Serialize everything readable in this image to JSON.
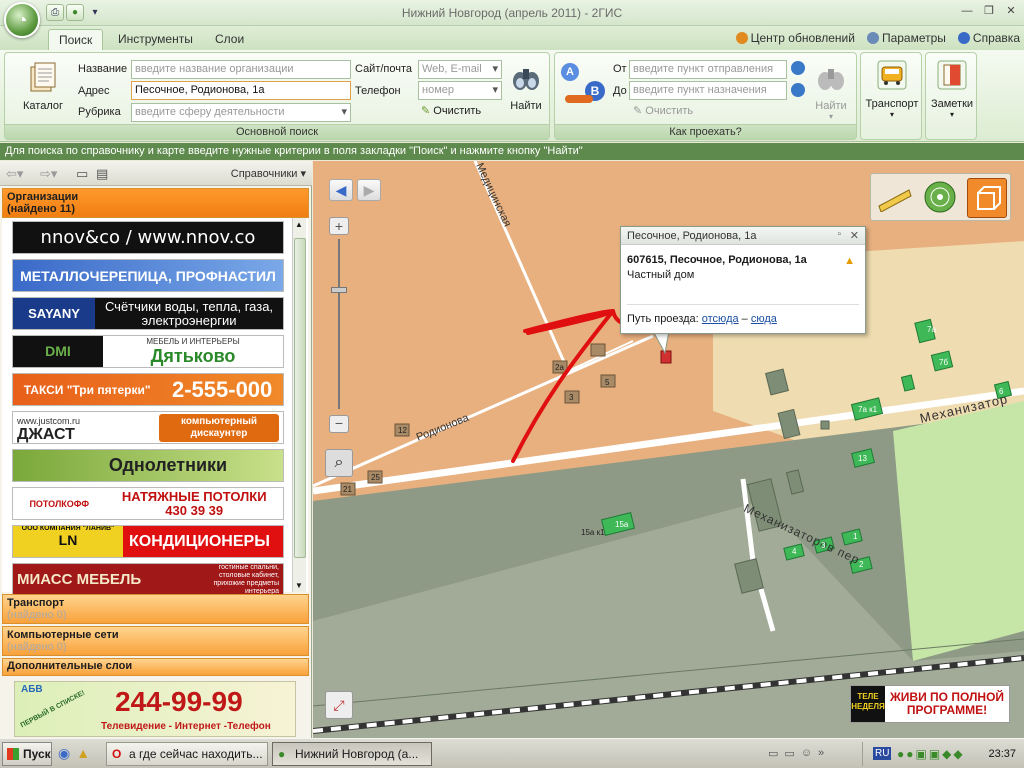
{
  "window": {
    "title": "Нижний Новгород (апрель 2011) - 2ГИС"
  },
  "ribbon_tabs": [
    {
      "label": "Поиск"
    },
    {
      "label": "Инструменты"
    },
    {
      "label": "Слои"
    }
  ],
  "ribbon_right": {
    "updates": "Центр обновлений",
    "params": "Параметры",
    "help": "Справка"
  },
  "search_group": {
    "catalog_label": "Каталог",
    "name_label": "Название",
    "name_placeholder": "введите название организации",
    "address_label": "Адрес",
    "address_value": "Песочное, Родионова, 1а",
    "rubric_label": "Рубрика",
    "rubric_placeholder": "введите сферу деятельности",
    "site_label": "Сайт/почта",
    "site_placeholder": "Web, E-mail",
    "phone_label": "Телефон",
    "phone_placeholder": "номер",
    "clear_label": "Очистить",
    "find_label": "Найти",
    "group_label": "Основной поиск"
  },
  "route_group": {
    "from_label": "От",
    "from_placeholder": "введите пункт отправления",
    "to_label": "До",
    "to_placeholder": "введите пункт назначения",
    "clear_label": "Очистить",
    "find_label": "Найти",
    "group_label": "Как проехать?",
    "badge_a": "A",
    "badge_b": "B"
  },
  "transport_label": "Транспорт",
  "notes_label": "Заметки",
  "infobar": "Для поиска по справочнику и карте введите нужные критерии в поля закладки \"Поиск\" и нажмите кнопку \"Найти\"",
  "leftpanel": {
    "directories_label": "Справочники",
    "categories": [
      {
        "title": "Организации",
        "count": "(найдено 11)"
      },
      {
        "title": "Транспорт",
        "count": "(найдено 0)"
      },
      {
        "title": "Компьютерные сети",
        "count": "(найдено 0)"
      },
      {
        "title": "Дополнительные слои",
        "count": ""
      }
    ],
    "banners": [
      {
        "text": "nnov&co  /  www.nnov.co"
      },
      {
        "text": "МЕТАЛЛОЧЕРЕПИЦА, ПРОФНАСТИЛ"
      },
      {
        "text": "SAYANY",
        "sub": "Счётчики воды, тепла, газа, электроэнергии"
      },
      {
        "text": "Дятьково",
        "sub": "МЕБЕЛЬ И ИНТЕРЬЕРЫ"
      },
      {
        "text": "ТАКСИ \"Три пятерки\"",
        "sub": "2-555-000"
      },
      {
        "text": "ДЖАСТ",
        "sub": "компьютерный дискаунтер",
        "url": "www.justcom.ru"
      },
      {
        "text": "Однолетники"
      },
      {
        "text": "НАТЯЖНЫЕ ПОТОЛКИ",
        "sub": "430 39 39",
        "brand": "ПОТОЛКОФФ"
      },
      {
        "text": "КОНДИЦИОНЕРЫ",
        "brand": "ООО КОМПАНИЯ \"ЛАНИВ\""
      },
      {
        "text": "МИАСС МЕБЕЛЬ",
        "sub": "гостиные спальни, столовые кабинет, прихожие предметы интерьера"
      }
    ],
    "bottom_ad": {
      "phone": "244-99-99",
      "tagline": "Телевидение - Интернет -Телефон",
      "brand": "АБВ",
      "ribbon": "ПЕРВЫЙ В СПИСКЕ!"
    }
  },
  "map": {
    "street_labels": {
      "rodionova": "Родионова",
      "medinskaya": "Медицинская",
      "mekhanizatorov": "Механизатор",
      "mekhanizatorov_per": "Механизаторов пер"
    },
    "house_numbers": [
      "1а",
      "7а",
      "7б",
      "7а к1",
      "6",
      "13",
      "15а",
      "15а к1",
      "1",
      "2",
      "3",
      "4",
      "5",
      "12",
      "21",
      "25",
      "2а",
      "3"
    ],
    "popup": {
      "header": "Песочное, Родионова, 1а",
      "address": "607615, Песочное, Родионова, 1а",
      "kind": "Частный дом",
      "route_prefix": "Путь проезда:",
      "route_from": "отсюда",
      "route_dash": "–",
      "route_to": "сюда"
    },
    "ad": {
      "brand": "ТЕЛЕ НЕДЕЛЯ",
      "text": "ЖИВИ ПО ПОЛНОЙ ПРОГРАММЕ!"
    }
  },
  "taskbar": {
    "start": "Пуск",
    "tasks": [
      {
        "label": "а где сейчас находить..."
      },
      {
        "label": "Нижний Новгород (а..."
      }
    ],
    "lang": "RU",
    "clock": "23:37"
  },
  "colors": {
    "map_orange": "#e8b07f",
    "map_cream": "#efdcb0",
    "map_green": "#c6e6a8",
    "map_gray": "#8e9a85",
    "arrow": "#e01010"
  }
}
